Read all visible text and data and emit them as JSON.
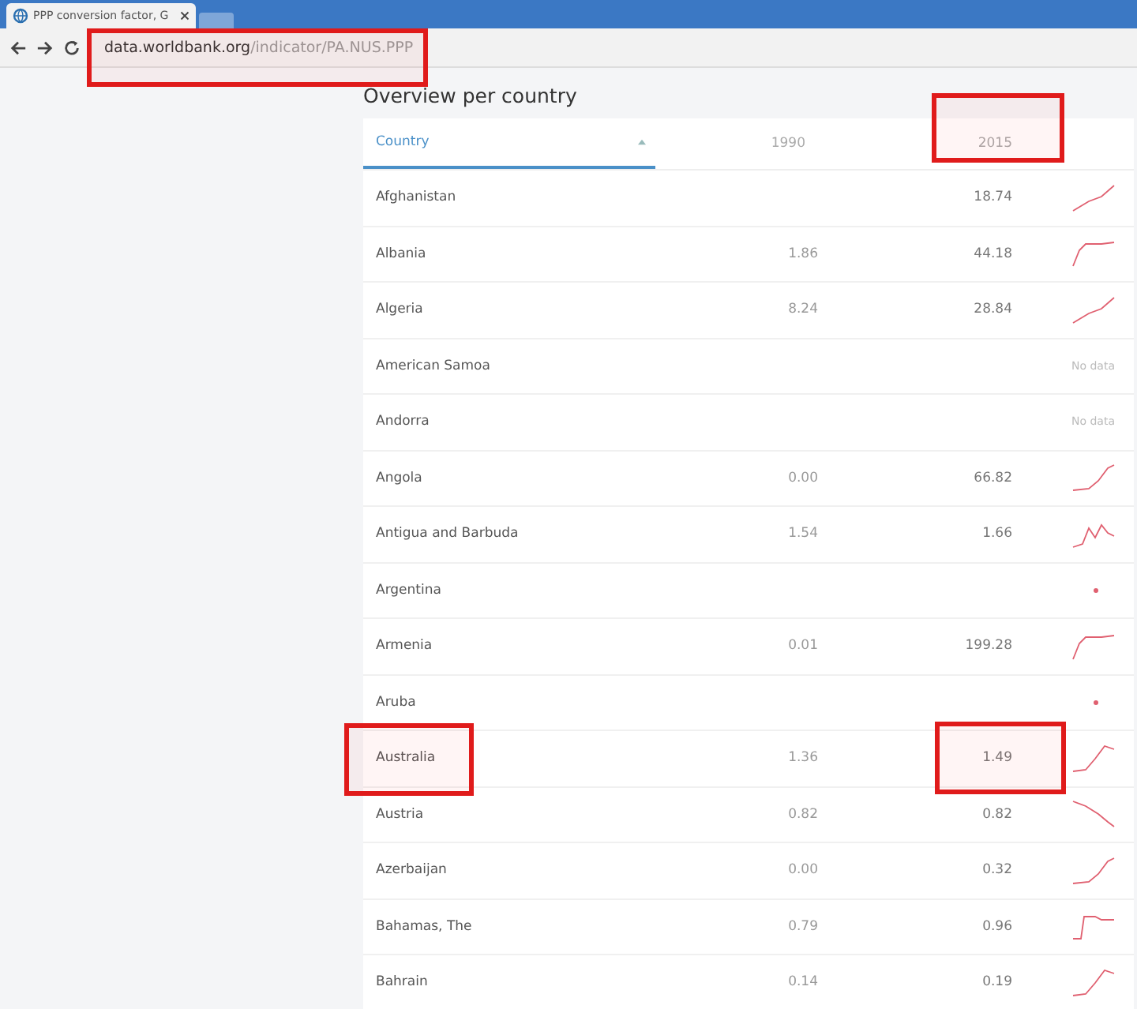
{
  "browser": {
    "tab_title": "PPP conversion factor, G",
    "url_domain": "data.worldbank.org",
    "url_path": "/indicator/PA.NUS.PPP",
    "url_highlighted": true
  },
  "section_title": "Overview per country",
  "table": {
    "columns": [
      {
        "label": "Country",
        "sorted": true,
        "highlighted": false
      },
      {
        "label": "1990",
        "sorted": false,
        "highlighted": false
      },
      {
        "label": "2015",
        "sorted": false,
        "highlighted": true
      }
    ],
    "rows": [
      {
        "country": "Afghanistan",
        "v1990": "",
        "v2015": "18.74",
        "highlighted": false
      },
      {
        "country": "Albania",
        "v1990": "1.86",
        "v2015": "44.18",
        "highlighted": false
      },
      {
        "country": "Algeria",
        "v1990": "8.24",
        "v2015": "28.84",
        "highlighted": false
      },
      {
        "country": "American Samoa",
        "v1990": "",
        "v2015": "",
        "note": "No data",
        "highlighted": false
      },
      {
        "country": "Andorra",
        "v1990": "",
        "v2015": "",
        "note": "No data",
        "highlighted": false
      },
      {
        "country": "Angola",
        "v1990": "0.00",
        "v2015": "66.82",
        "highlighted": false
      },
      {
        "country": "Antigua and Barbuda",
        "v1990": "1.54",
        "v2015": "1.66",
        "highlighted": false
      },
      {
        "country": "Argentina",
        "v1990": "",
        "v2015": "",
        "highlighted": false
      },
      {
        "country": "Armenia",
        "v1990": "0.01",
        "v2015": "199.28",
        "highlighted": false
      },
      {
        "country": "Aruba",
        "v1990": "",
        "v2015": "",
        "highlighted": false
      },
      {
        "country": "Australia",
        "v1990": "1.36",
        "v2015": "1.49",
        "highlighted": true
      },
      {
        "country": "Austria",
        "v1990": "0.82",
        "v2015": "0.82",
        "highlighted": false
      },
      {
        "country": "Azerbaijan",
        "v1990": "0.00",
        "v2015": "0.32",
        "highlighted": false
      },
      {
        "country": "Bahamas, The",
        "v1990": "0.79",
        "v2015": "0.96",
        "highlighted": false
      },
      {
        "country": "Bahrain",
        "v1990": "0.14",
        "v2015": "0.19",
        "highlighted": false
      }
    ]
  }
}
